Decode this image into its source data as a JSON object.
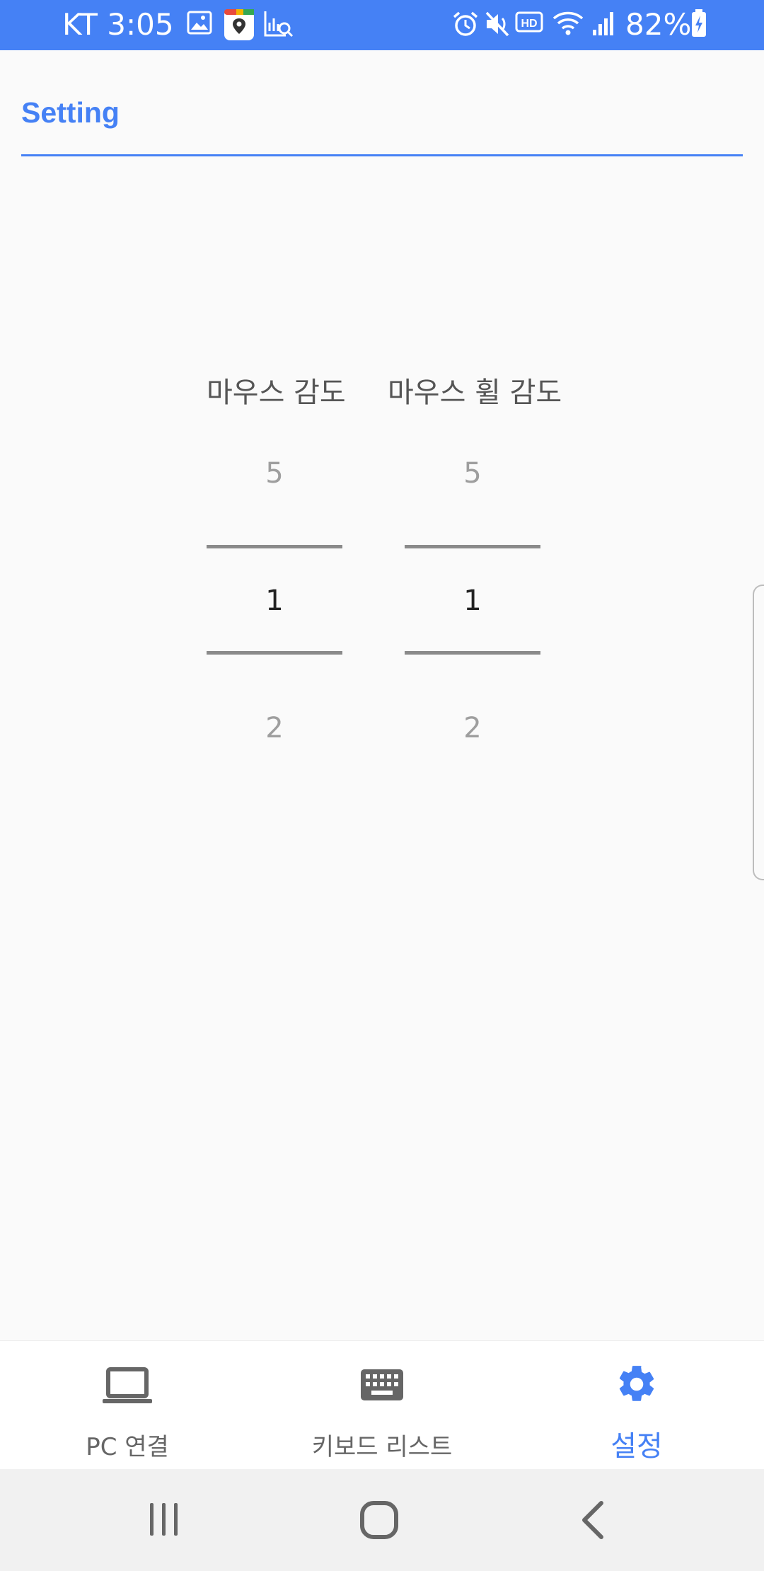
{
  "status_bar": {
    "carrier_time": "KT 3:05",
    "battery": "82%",
    "icons": [
      "image-icon",
      "maps-app-icon",
      "chart-search-icon",
      "alarm-icon",
      "mute-icon",
      "hd-icon",
      "wifi-icon",
      "signal-icon",
      "battery-charging-icon"
    ]
  },
  "header": {
    "title": "Setting",
    "accent": "#4581f5"
  },
  "pickers": [
    {
      "label": "마우스 감도",
      "prev": "5",
      "current": "1",
      "next": "2"
    },
    {
      "label": "마우스 휠 감도",
      "prev": "5",
      "current": "1",
      "next": "2"
    }
  ],
  "bottom_nav": {
    "items": [
      {
        "label": "PC 연결",
        "icon": "laptop-icon",
        "active": false
      },
      {
        "label": "키보드 리스트",
        "icon": "keyboard-icon",
        "active": false
      },
      {
        "label": "설정",
        "icon": "gear-icon",
        "active": true
      }
    ]
  },
  "system_nav": {
    "buttons": [
      "recents-icon",
      "home-icon",
      "back-icon"
    ]
  }
}
